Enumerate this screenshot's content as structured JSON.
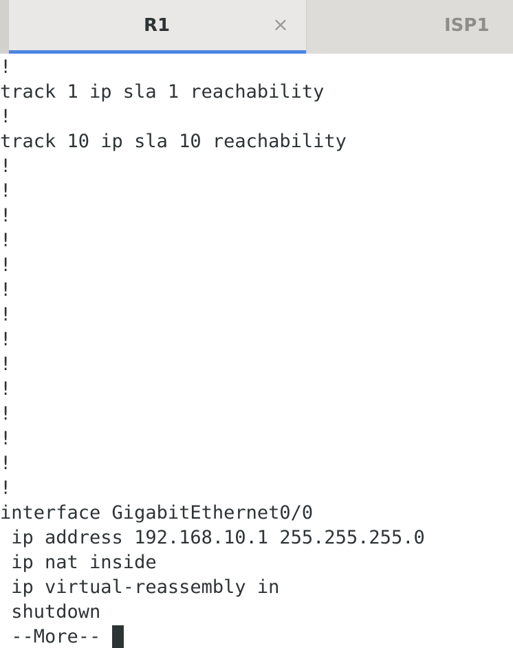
{
  "tabs": [
    {
      "label": "R1",
      "active": true,
      "close_glyph": "×"
    },
    {
      "label": "ISP1",
      "active": false
    }
  ],
  "terminal": {
    "lines": [
      "!",
      "track 1 ip sla 1 reachability",
      "!",
      "track 10 ip sla 10 reachability",
      "!",
      "!",
      "!",
      "!",
      "!",
      "!",
      "!",
      "!",
      "!",
      "!",
      "!",
      "!",
      "!",
      "!",
      "interface GigabitEthernet0/0",
      " ip address 192.168.10.1 255.255.255.0",
      " ip nat inside",
      " ip virtual-reassembly in",
      " shutdown"
    ],
    "more_prompt": " --More-- "
  },
  "colors": {
    "tab_indicator": "#4a86e0",
    "text": "#2e3436",
    "inactive_tab_text": "#8f8d8a",
    "background": "#ffffff"
  }
}
